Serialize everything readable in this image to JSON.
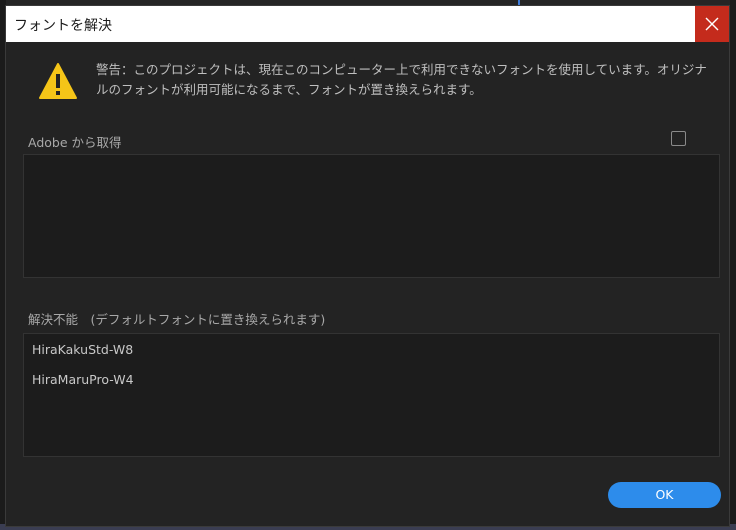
{
  "dialog": {
    "title": "フォントを解決",
    "close_icon": "close-icon",
    "warning_icon": "warning-icon",
    "warning_text": "警告：このプロジェクトは、現在このコンピューター上で利用できないフォントを使用しています。オリジナルのフォントが利用可能になるまで、フォントが置き換えられます。",
    "adobe_section": {
      "label": "Adobe から取得",
      "checkbox_checked": false,
      "items": []
    },
    "unresolved_section": {
      "label": "解決不能　(デフォルトフォントに置き換えられます)",
      "items": [
        "HiraKakuStd-W8",
        "HiraMaruPro-W4"
      ]
    },
    "ok_label": "OK"
  },
  "colors": {
    "accent": "#2d8ceb",
    "close": "#c42b1c",
    "warning": "#f5c518"
  }
}
